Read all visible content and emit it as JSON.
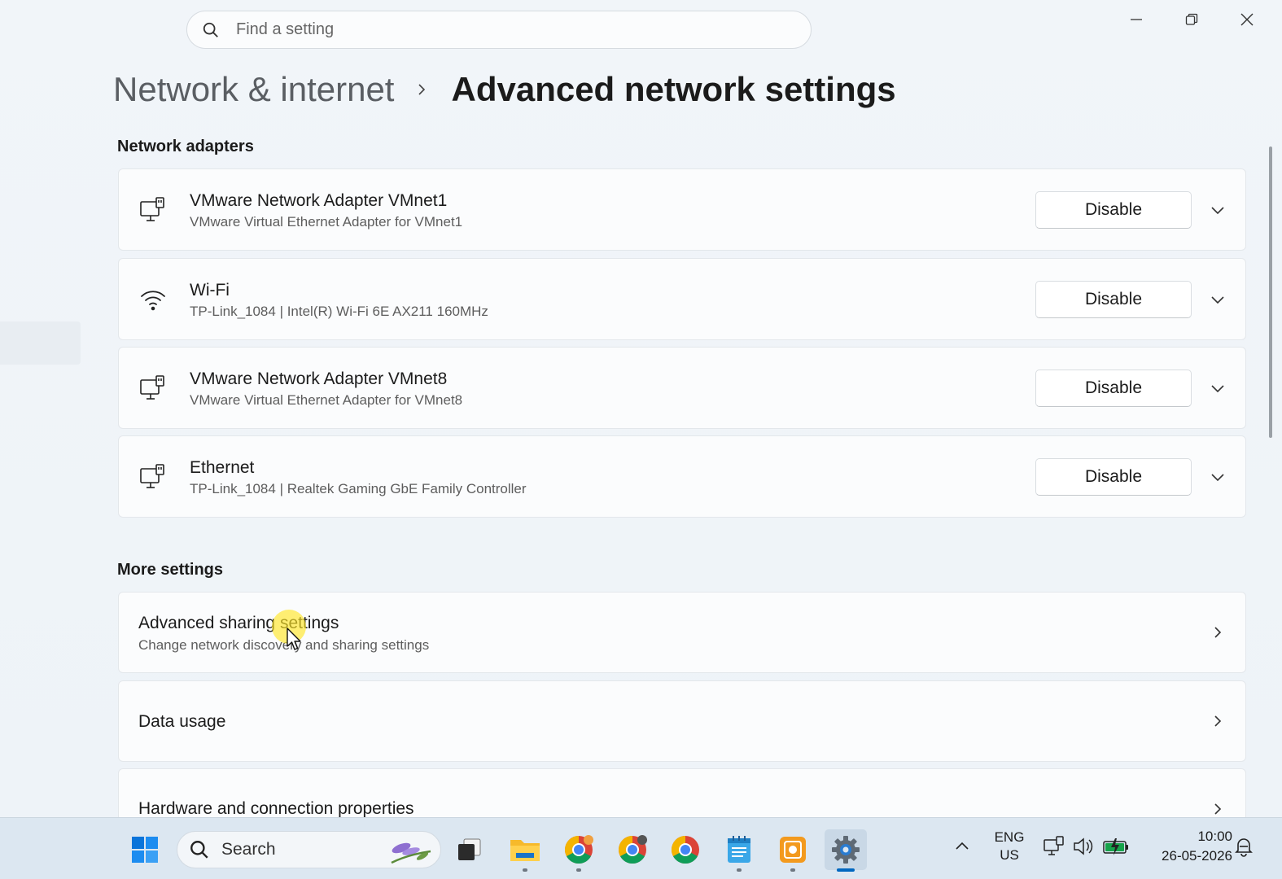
{
  "search": {
    "placeholder": "Find a setting"
  },
  "window_controls": {
    "minimize": "minimize-icon",
    "restore": "restore-icon",
    "close": "close-icon"
  },
  "breadcrumb": {
    "parent": "Network & internet",
    "current": "Advanced network settings"
  },
  "network_adapters": {
    "title": "Network adapters",
    "items": [
      {
        "name": "VMware Network Adapter VMnet1",
        "description": "VMware Virtual Ethernet Adapter for VMnet1",
        "icon": "ethernet-icon",
        "button": "Disable"
      },
      {
        "name": "Wi-Fi",
        "description": "TP-Link_1084 | Intel(R) Wi-Fi 6E AX211 160MHz",
        "icon": "wifi-icon",
        "button": "Disable"
      },
      {
        "name": "VMware Network Adapter VMnet8",
        "description": "VMware Virtual Ethernet Adapter for VMnet8",
        "icon": "ethernet-icon",
        "button": "Disable"
      },
      {
        "name": "Ethernet",
        "description": "TP-Link_1084 | Realtek Gaming GbE Family Controller",
        "icon": "ethernet-icon",
        "button": "Disable"
      }
    ]
  },
  "more_settings": {
    "title": "More settings",
    "items": [
      {
        "title": "Advanced sharing settings",
        "description": "Change network discovery and sharing settings"
      },
      {
        "title": "Data usage"
      },
      {
        "title": "Hardware and connection properties"
      }
    ]
  },
  "taskbar": {
    "search_label": "Search",
    "apps": [
      "start-icon",
      "task-view-icon",
      "file-explorer-icon",
      "chrome-icon",
      "chrome-icon",
      "chrome-icon",
      "notepad-icon",
      "snipping-tool-icon",
      "settings-icon"
    ],
    "active_app": "settings-icon"
  },
  "tray": {
    "language_line1": "ENG",
    "language_line2": "US",
    "time": "10:00",
    "date": "26-05-2026"
  },
  "colors": {
    "accent": "#0067c0",
    "background": "#eef3f8",
    "card": "#fbfcfd",
    "taskbar": "#dce7f1"
  }
}
